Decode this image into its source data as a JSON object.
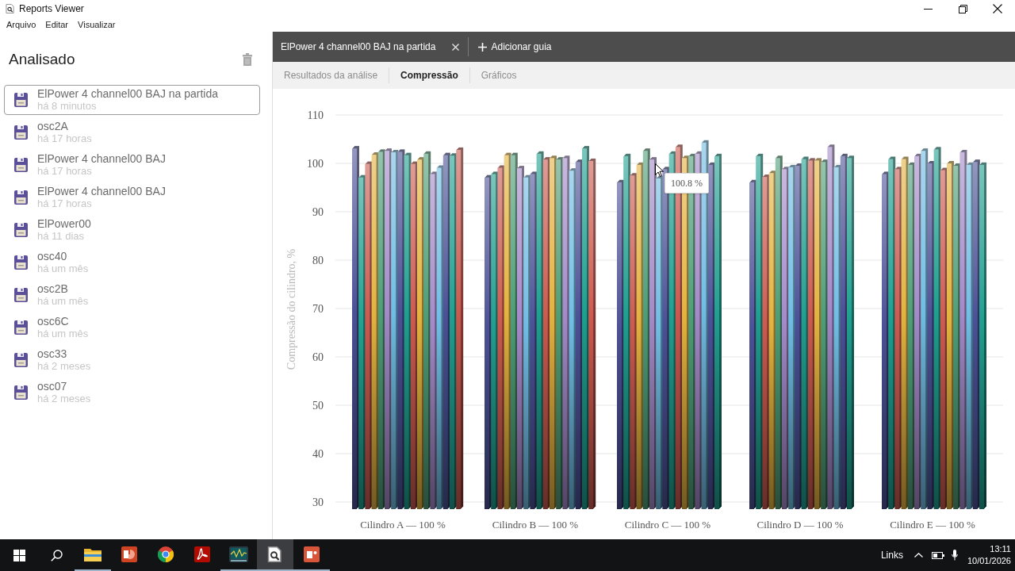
{
  "window": {
    "title": "Reports Viewer"
  },
  "menu": [
    "Arquivo",
    "Editar",
    "Visualizar"
  ],
  "sidebar": {
    "title": "Analisado",
    "items": [
      {
        "title": "ElPower 4 channel00 BAJ na partida",
        "subtitle": "há 8 minutos",
        "selected": true
      },
      {
        "title": "osc2A",
        "subtitle": "há 17 horas",
        "selected": false
      },
      {
        "title": "ElPower 4 channel00 BAJ",
        "subtitle": "há 17 horas",
        "selected": false
      },
      {
        "title": "ElPower 4 channel00 BAJ",
        "subtitle": "há 17 horas",
        "selected": false
      },
      {
        "title": "ElPower00",
        "subtitle": "há 11 dias",
        "selected": false
      },
      {
        "title": "osc40",
        "subtitle": "há um mês",
        "selected": false
      },
      {
        "title": "osc2B",
        "subtitle": "há um mês",
        "selected": false
      },
      {
        "title": "osc6C",
        "subtitle": "há um mês",
        "selected": false
      },
      {
        "title": "osc33",
        "subtitle": "há 2 meses",
        "selected": false
      },
      {
        "title": "osc07",
        "subtitle": "há 2 meses",
        "selected": false
      }
    ]
  },
  "main": {
    "document_tabs": [
      {
        "label": "ElPower 4 channel00 BAJ na partida"
      }
    ],
    "add_tab": "Adicionar guia",
    "view_tabs": [
      {
        "label": "Resultados da análise",
        "selected": false
      },
      {
        "label": "Compressão",
        "selected": true
      },
      {
        "label": "Gráficos",
        "selected": false
      }
    ],
    "chart": {
      "tooltip": "100.8 %",
      "chart_data": {
        "type": "bar",
        "grid": true,
        "ylabel": "Compressão do cilindro, %",
        "categories": [
          "Cilindro A — 100 %",
          "Cilindro B — 100 %",
          "Cilindro C — 100 %",
          "Cilindro D — 100 %",
          "Cilindro E — 100 %"
        ],
        "ylim": [
          30,
          110
        ],
        "yticks": [
          30,
          40,
          50,
          60,
          70,
          80,
          90,
          100,
          110
        ],
        "series": [
          {
            "color": "#4b5196",
            "values": [
              103.1,
              97.1,
              96.1,
              96.1,
              97.8
            ]
          },
          {
            "color": "#20a090",
            "values": [
              97.1,
              97.8,
              101.5,
              101.5,
              100.9
            ]
          },
          {
            "color": "#cc5a50",
            "values": [
              99.9,
              99.1,
              97.5,
              97.2,
              98.8
            ]
          },
          {
            "color": "#e3b340",
            "values": [
              101.8,
              101.7,
              99.7,
              98,
              100.9
            ]
          },
          {
            "color": "#4f9e78",
            "values": [
              102.4,
              101.7,
              102.6,
              101.1,
              99.7
            ]
          },
          {
            "color": "#a48ac8",
            "values": [
              102.6,
              99,
              100.8,
              98.8,
              101.5
            ]
          },
          {
            "color": "#70bde3",
            "values": [
              102.3,
              97.1,
              96.9,
              99.2,
              102.6
            ]
          },
          {
            "color": "#4b5196",
            "values": [
              102.4,
              97.8,
              98.8,
              99.5,
              100
            ]
          },
          {
            "color": "#20a090",
            "values": [
              101.7,
              102,
              102,
              100.9,
              102.9
            ]
          },
          {
            "color": "#cc5a50",
            "values": [
              99.9,
              100.8,
              103.4,
              100.6,
              98.6
            ]
          },
          {
            "color": "#e3b340",
            "values": [
              100.8,
              101.1,
              101.1,
              100.6,
              100
            ]
          },
          {
            "color": "#4f9e78",
            "values": [
              102,
              100.8,
              101.5,
              100.3,
              99.5
            ]
          },
          {
            "color": "#a48ac8",
            "values": [
              97.8,
              101.1,
              102,
              103.4,
              102.3
            ]
          },
          {
            "color": "#70bde3",
            "values": [
              99.1,
              98.5,
              104.3,
              99.2,
              99.7
            ]
          },
          {
            "color": "#4b5196",
            "values": [
              101.7,
              100.3,
              99.7,
              101.5,
              100.3
            ]
          },
          {
            "color": "#20a090",
            "values": [
              101.6,
              103.1,
              101.5,
              101.1,
              99.7
            ]
          },
          {
            "color": "#cc5a50",
            "values": [
              102.8,
              100.5,
              null,
              null,
              null
            ]
          }
        ]
      }
    }
  },
  "taskbar": {
    "apps": [
      {
        "kind": "folder",
        "running": true,
        "selected": false
      },
      {
        "kind": "slides",
        "running": false,
        "selected": false
      },
      {
        "kind": "browser",
        "running": false,
        "selected": false
      },
      {
        "kind": "pdf",
        "running": false,
        "selected": false
      },
      {
        "kind": "scope",
        "running": true,
        "selected": false
      },
      {
        "kind": "viewer",
        "running": true,
        "selected": true
      },
      {
        "kind": "photo",
        "running": true,
        "selected": false
      }
    ],
    "tray": {
      "links": "Links",
      "time": "13:11",
      "date": "10/01/2026"
    }
  }
}
